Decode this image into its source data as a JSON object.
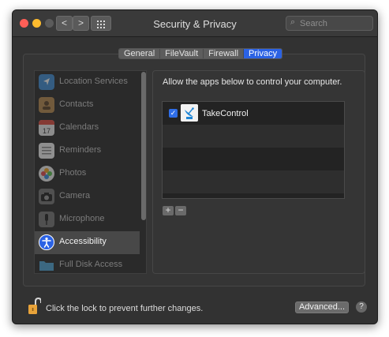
{
  "window": {
    "title": "Security & Privacy"
  },
  "toolbar": {
    "back_glyph": "<",
    "forward_glyph": ">",
    "search_placeholder": "Search"
  },
  "tabs": [
    {
      "label": "General"
    },
    {
      "label": "FileVault"
    },
    {
      "label": "Firewall"
    },
    {
      "label": "Privacy"
    }
  ],
  "sidebar": {
    "items": [
      {
        "label": "Location Services",
        "icon": "location-arrow-icon"
      },
      {
        "label": "Contacts",
        "icon": "contacts-book-icon"
      },
      {
        "label": "Calendars",
        "icon": "calendar-icon"
      },
      {
        "label": "Reminders",
        "icon": "reminders-list-icon"
      },
      {
        "label": "Photos",
        "icon": "photos-flower-icon"
      },
      {
        "label": "Camera",
        "icon": "camera-icon"
      },
      {
        "label": "Microphone",
        "icon": "microphone-icon"
      },
      {
        "label": "Accessibility",
        "icon": "accessibility-icon"
      },
      {
        "label": "Full Disk Access",
        "icon": "folder-icon"
      }
    ],
    "selected": "Accessibility"
  },
  "main": {
    "heading": "Allow the apps below to control your computer.",
    "apps": [
      {
        "name": "TakeControl",
        "checked": true,
        "icon": "satellite-dish-icon"
      }
    ],
    "add_glyph": "+",
    "remove_glyph": "−"
  },
  "footer": {
    "lock_text": "Click the lock to prevent further changes.",
    "advanced_label": "Advanced...",
    "help_glyph": "?"
  },
  "colors": {
    "accent": "#2b62e4",
    "close": "#ff5f57",
    "minimize": "#febc2e",
    "zoom": "#5b5b5b",
    "lock": "#e8a33a"
  }
}
